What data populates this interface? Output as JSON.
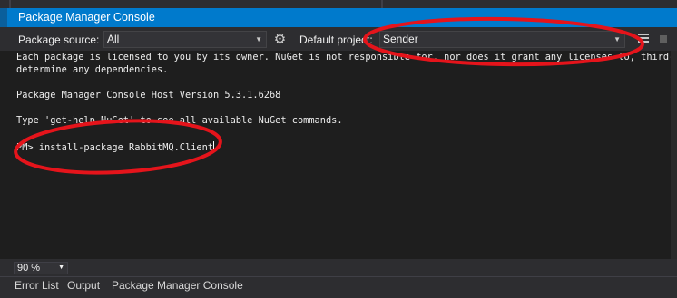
{
  "window": {
    "title": "Package Manager Console"
  },
  "toolbar": {
    "package_source_label": "Package source:",
    "package_source_value": "All",
    "settings_icon": "gear-icon",
    "default_project_label": "Default project:",
    "default_project_value": "Sender",
    "clear_icon": "clear-console-icon",
    "stop_icon": "stop-icon"
  },
  "console": {
    "line1": "Each package is licensed to you by its owner. NuGet is not responsible for, nor does it grant any licenses to, third-party",
    "line2": "determine any dependencies.",
    "line3": "Package Manager Console Host Version 5.3.1.6268",
    "line4": "Type 'get-help NuGet' to see all available NuGet commands.",
    "prompt": "PM> ",
    "command": "install-package RabbitMQ.Client"
  },
  "status": {
    "zoom": "90 %"
  },
  "bottom_tabs": [
    {
      "label": "Error List"
    },
    {
      "label": "Output"
    },
    {
      "label": "Package Manager Console"
    }
  ],
  "colors": {
    "accent": "#007acc",
    "background": "#1e1e1e",
    "toolbar": "#2d2d30",
    "annotation": "#e5141b"
  }
}
